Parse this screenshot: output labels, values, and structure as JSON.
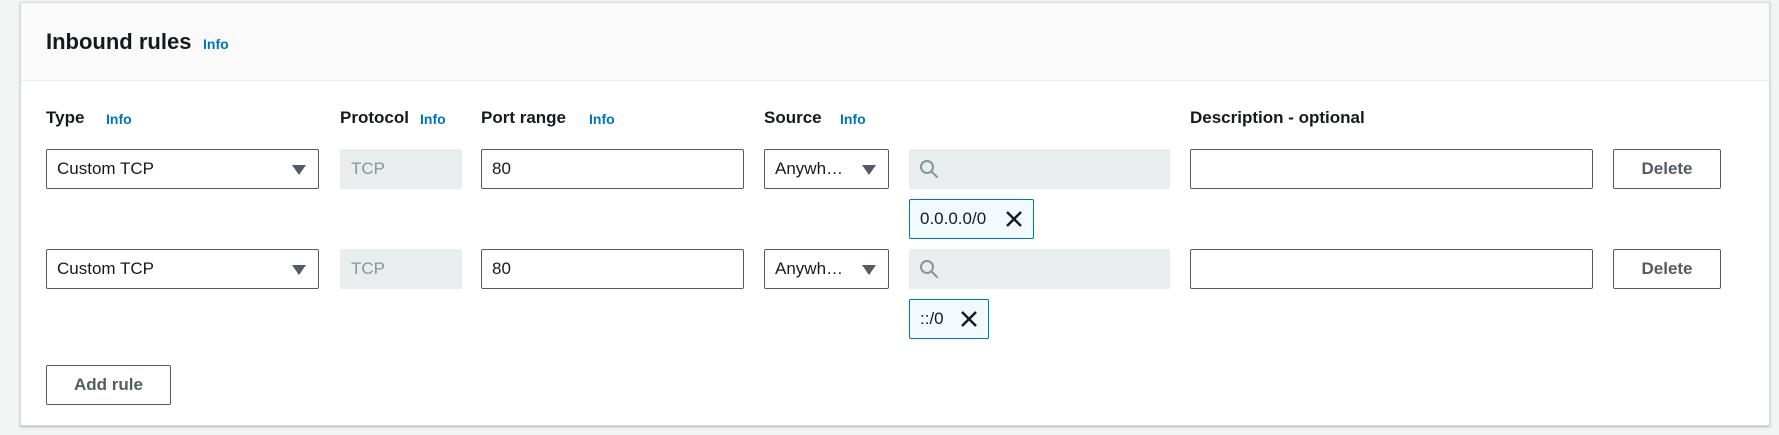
{
  "header": {
    "title": "Inbound rules",
    "info": "Info"
  },
  "columns": {
    "type": {
      "label": "Type",
      "info": "Info"
    },
    "protocol": {
      "label": "Protocol",
      "info": "Info"
    },
    "port_range": {
      "label": "Port range",
      "info": "Info"
    },
    "source": {
      "label": "Source",
      "info": "Info"
    },
    "description": {
      "label": "Description - optional"
    }
  },
  "rules": [
    {
      "type": "Custom TCP",
      "protocol": "TCP",
      "port_range": "80",
      "source": "Anywh…",
      "search_value": "",
      "token": "0.0.0.0/0",
      "description": "",
      "delete_label": "Delete"
    },
    {
      "type": "Custom TCP",
      "protocol": "TCP",
      "port_range": "80",
      "source": "Anywh…",
      "search_value": "",
      "token": "::/0",
      "description": "",
      "delete_label": "Delete"
    }
  ],
  "actions": {
    "add_rule_label": "Add rule"
  },
  "icons": {
    "dropdown": "caret-down-icon",
    "search": "search-icon",
    "remove": "close-icon"
  },
  "colors": {
    "link": "#0073bb",
    "border": "#545b64",
    "readonly_bg": "#eaeded",
    "token_border": "#0073bb"
  }
}
